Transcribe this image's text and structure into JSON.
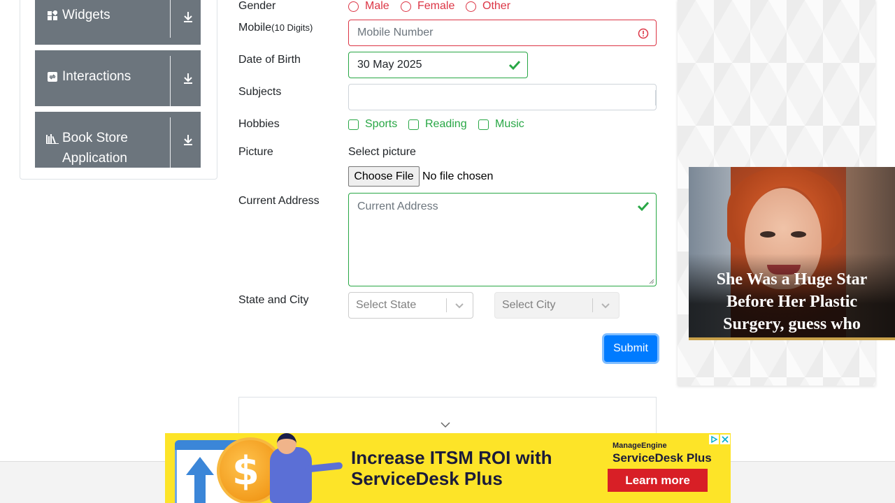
{
  "sidebar": {
    "groups": [
      {
        "label": "Widgets",
        "icon": "widgets-icon"
      },
      {
        "label": "Interactions",
        "icon": "interactions-icon"
      },
      {
        "label": "Book Store Application",
        "label_line1": "Book Store",
        "label_line2": "Application",
        "icon": "book-store-icon"
      }
    ]
  },
  "form": {
    "gender": {
      "label": "Gender",
      "options": [
        "Male",
        "Female",
        "Other"
      ]
    },
    "mobile": {
      "label": "Mobile",
      "label_hint": "(10 Digits)",
      "placeholder": "Mobile Number",
      "value": ""
    },
    "dob": {
      "label": "Date of Birth",
      "value": "30 May 2025"
    },
    "subjects": {
      "label": "Subjects",
      "value": ""
    },
    "hobbies": {
      "label": "Hobbies",
      "options": [
        "Sports",
        "Reading",
        "Music"
      ]
    },
    "picture": {
      "label": "Picture",
      "prompt": "Select picture",
      "button_label": "Choose File",
      "status": "No file chosen"
    },
    "address": {
      "label": "Current Address",
      "placeholder": "Current Address"
    },
    "state_city": {
      "label": "State and City",
      "state_placeholder": "Select State",
      "city_placeholder": "Select City"
    },
    "submit_label": "Submit"
  },
  "right_ad": {
    "headline": "She Was a Huge Star Before Her Plastic Surgery, guess who"
  },
  "banner_ad": {
    "headline_line1": "Increase ITSM ROI with",
    "headline_line2": "ServiceDesk Plus",
    "brand_small": "ManageEngine",
    "brand_large": "ServiceDesk Plus",
    "cta": "Learn more",
    "coin_symbol": "$"
  },
  "colors": {
    "invalid": "#dc3545",
    "valid": "#28a745",
    "primary": "#007bff",
    "sidebar_header": "#6c757d",
    "banner_bg": "#fde428"
  }
}
